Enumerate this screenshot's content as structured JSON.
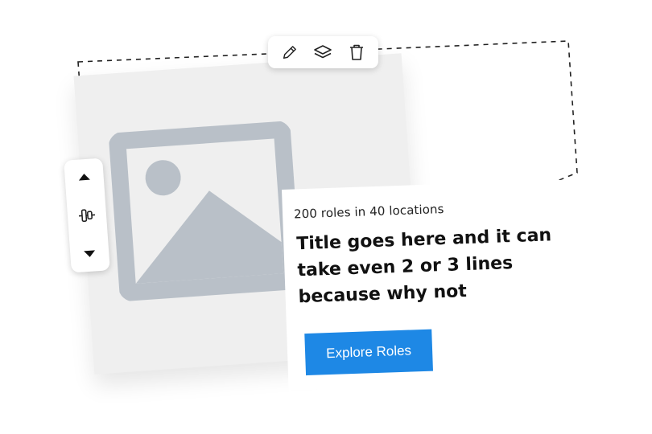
{
  "toolbar": {
    "tools": [
      {
        "name": "edit",
        "icon": "pencil-icon"
      },
      {
        "name": "layers",
        "icon": "layers-icon"
      },
      {
        "name": "delete",
        "icon": "trash-icon"
      }
    ]
  },
  "reorder": {
    "up_icon": "triangle-up-icon",
    "handle_icon": "align-center-handle-icon",
    "down_icon": "triangle-down-icon"
  },
  "placeholder": {
    "icon": "image-placeholder-icon",
    "color": "#b9c0c8"
  },
  "card": {
    "meta": "200 roles in 40 locations",
    "title": "Title goes here and it can take even 2 or 3 lines because why not",
    "cta_label": "Explore Roles",
    "cta_color": "#1e88e5"
  }
}
